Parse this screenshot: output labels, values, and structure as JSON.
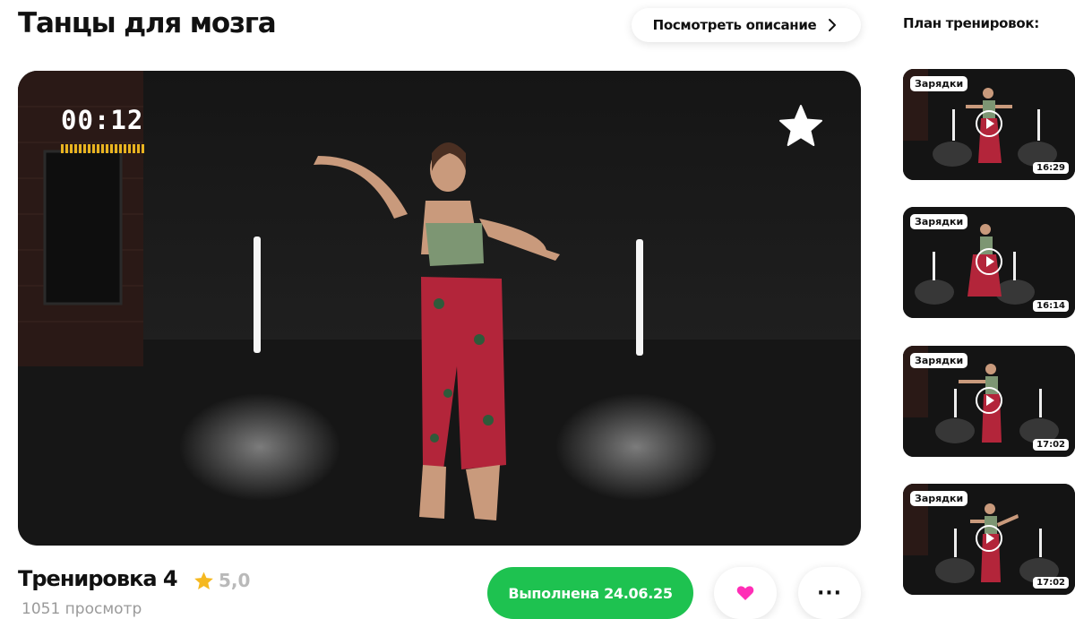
{
  "header": {
    "title": "Танцы для мозга",
    "description_button": "Посмотреть описание",
    "plan_title": "План тренировок:"
  },
  "player": {
    "timer": "00:12",
    "timer_color": "#e8b320",
    "favorite_icon": "star-icon"
  },
  "workout": {
    "title": "Тренировка 4",
    "rating": "5,0",
    "rating_color": "#f5b820",
    "views": "1051 просмотр",
    "done_button": "Выполнена 24.06.25",
    "done_color": "#1ec250",
    "like_color": "#ff2eb6"
  },
  "plan": [
    {
      "tag": "Зарядки",
      "duration": "16:29"
    },
    {
      "tag": "Зарядки",
      "duration": "16:14"
    },
    {
      "tag": "Зарядки",
      "duration": "17:02"
    },
    {
      "tag": "Зарядки",
      "duration": "17:02"
    }
  ]
}
